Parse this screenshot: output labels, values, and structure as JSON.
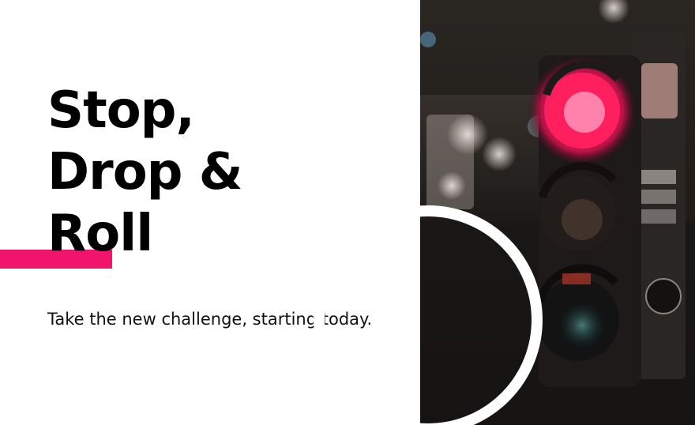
{
  "slide": {
    "title_lines": [
      "Stop,",
      "Drop &",
      "Roll"
    ],
    "subtitle": "Take the new challenge, starting today."
  },
  "photo": {
    "subject": "traffic-light-red",
    "colors": {
      "red_light": "#ff1f5e",
      "accent": "#f0146d",
      "background": "#ffffff"
    }
  }
}
